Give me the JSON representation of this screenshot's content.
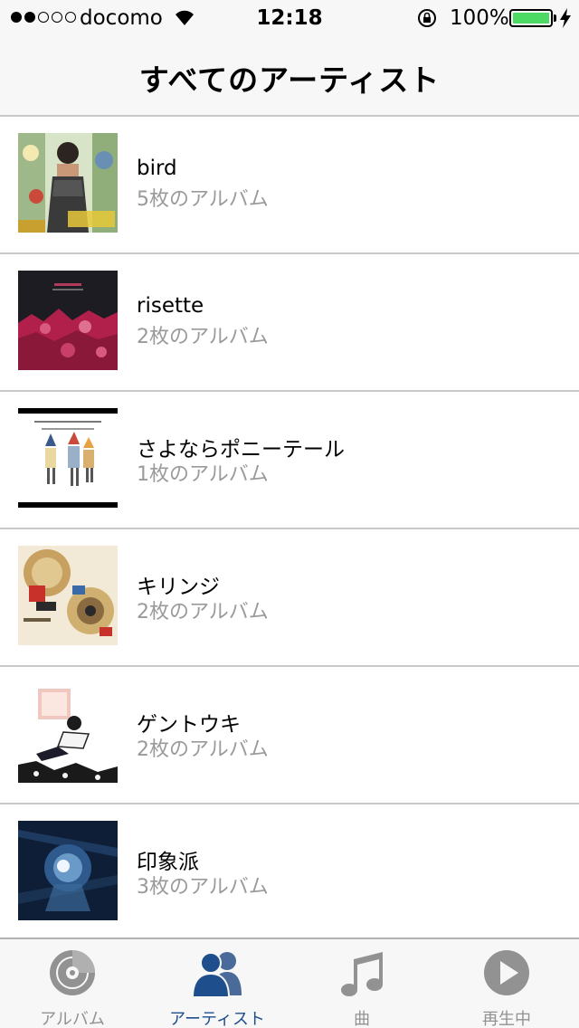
{
  "status_bar": {
    "signal_bars_filled": 2,
    "signal_bars_total": 5,
    "carrier": "docomo",
    "time": "12:18",
    "battery_percent": "100%",
    "battery_color": "#4cd964"
  },
  "nav": {
    "title": "すべてのアーティスト"
  },
  "artists": [
    {
      "name": "bird",
      "albums": "5枚のアルバム",
      "art_icon": "album-art-bird"
    },
    {
      "name": "risette",
      "albums": "2枚のアルバム",
      "art_icon": "album-art-risette"
    },
    {
      "name": "さよならポニーテール",
      "albums": "1枚のアルバム",
      "art_icon": "album-art-sayonara-ponytail"
    },
    {
      "name": "キリンジ",
      "albums": "2枚のアルバム",
      "art_icon": "album-art-kirinji"
    },
    {
      "name": "ゲントウキ",
      "albums": "2枚のアルバム",
      "art_icon": "album-art-gentouki"
    },
    {
      "name": "印象派",
      "albums": "3枚のアルバム",
      "art_icon": "album-art-inshouha"
    }
  ],
  "tabbar": {
    "active_color": "#1f4e8c",
    "inactive_color": "#929292",
    "tabs": [
      {
        "label": "アルバム",
        "icon": "disc-icon",
        "active": false
      },
      {
        "label": "アーティスト",
        "icon": "people-icon",
        "active": true
      },
      {
        "label": "曲",
        "icon": "music-note-icon",
        "active": false
      },
      {
        "label": "再生中",
        "icon": "play-circle-icon",
        "active": false
      }
    ]
  }
}
